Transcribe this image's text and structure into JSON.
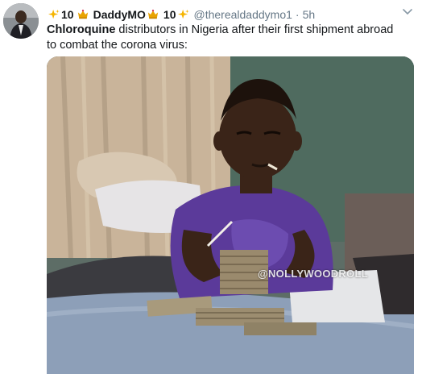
{
  "tweet": {
    "sparkle_prefix": "10",
    "display_name": "DaddyMO",
    "sparkle_suffix": "10",
    "handle": "@therealdaddymo1",
    "separator": "·",
    "time": "5h",
    "text_bold": "Chloroquine",
    "text_rest": " distributors in Nigeria after their first shipment abroad to combat the corona virus:"
  },
  "media": {
    "watermark": "@NOLLYWOODROLL"
  },
  "icons": {
    "avatar": "profile-photo",
    "sparkle": "sparkles-emoji",
    "crown": "crown-emoji",
    "menu": "chevron-down-icon"
  },
  "colors": {
    "text": "#14171a",
    "muted": "#657786",
    "sparkle": "#f5b400",
    "crown": "#e8a200"
  }
}
